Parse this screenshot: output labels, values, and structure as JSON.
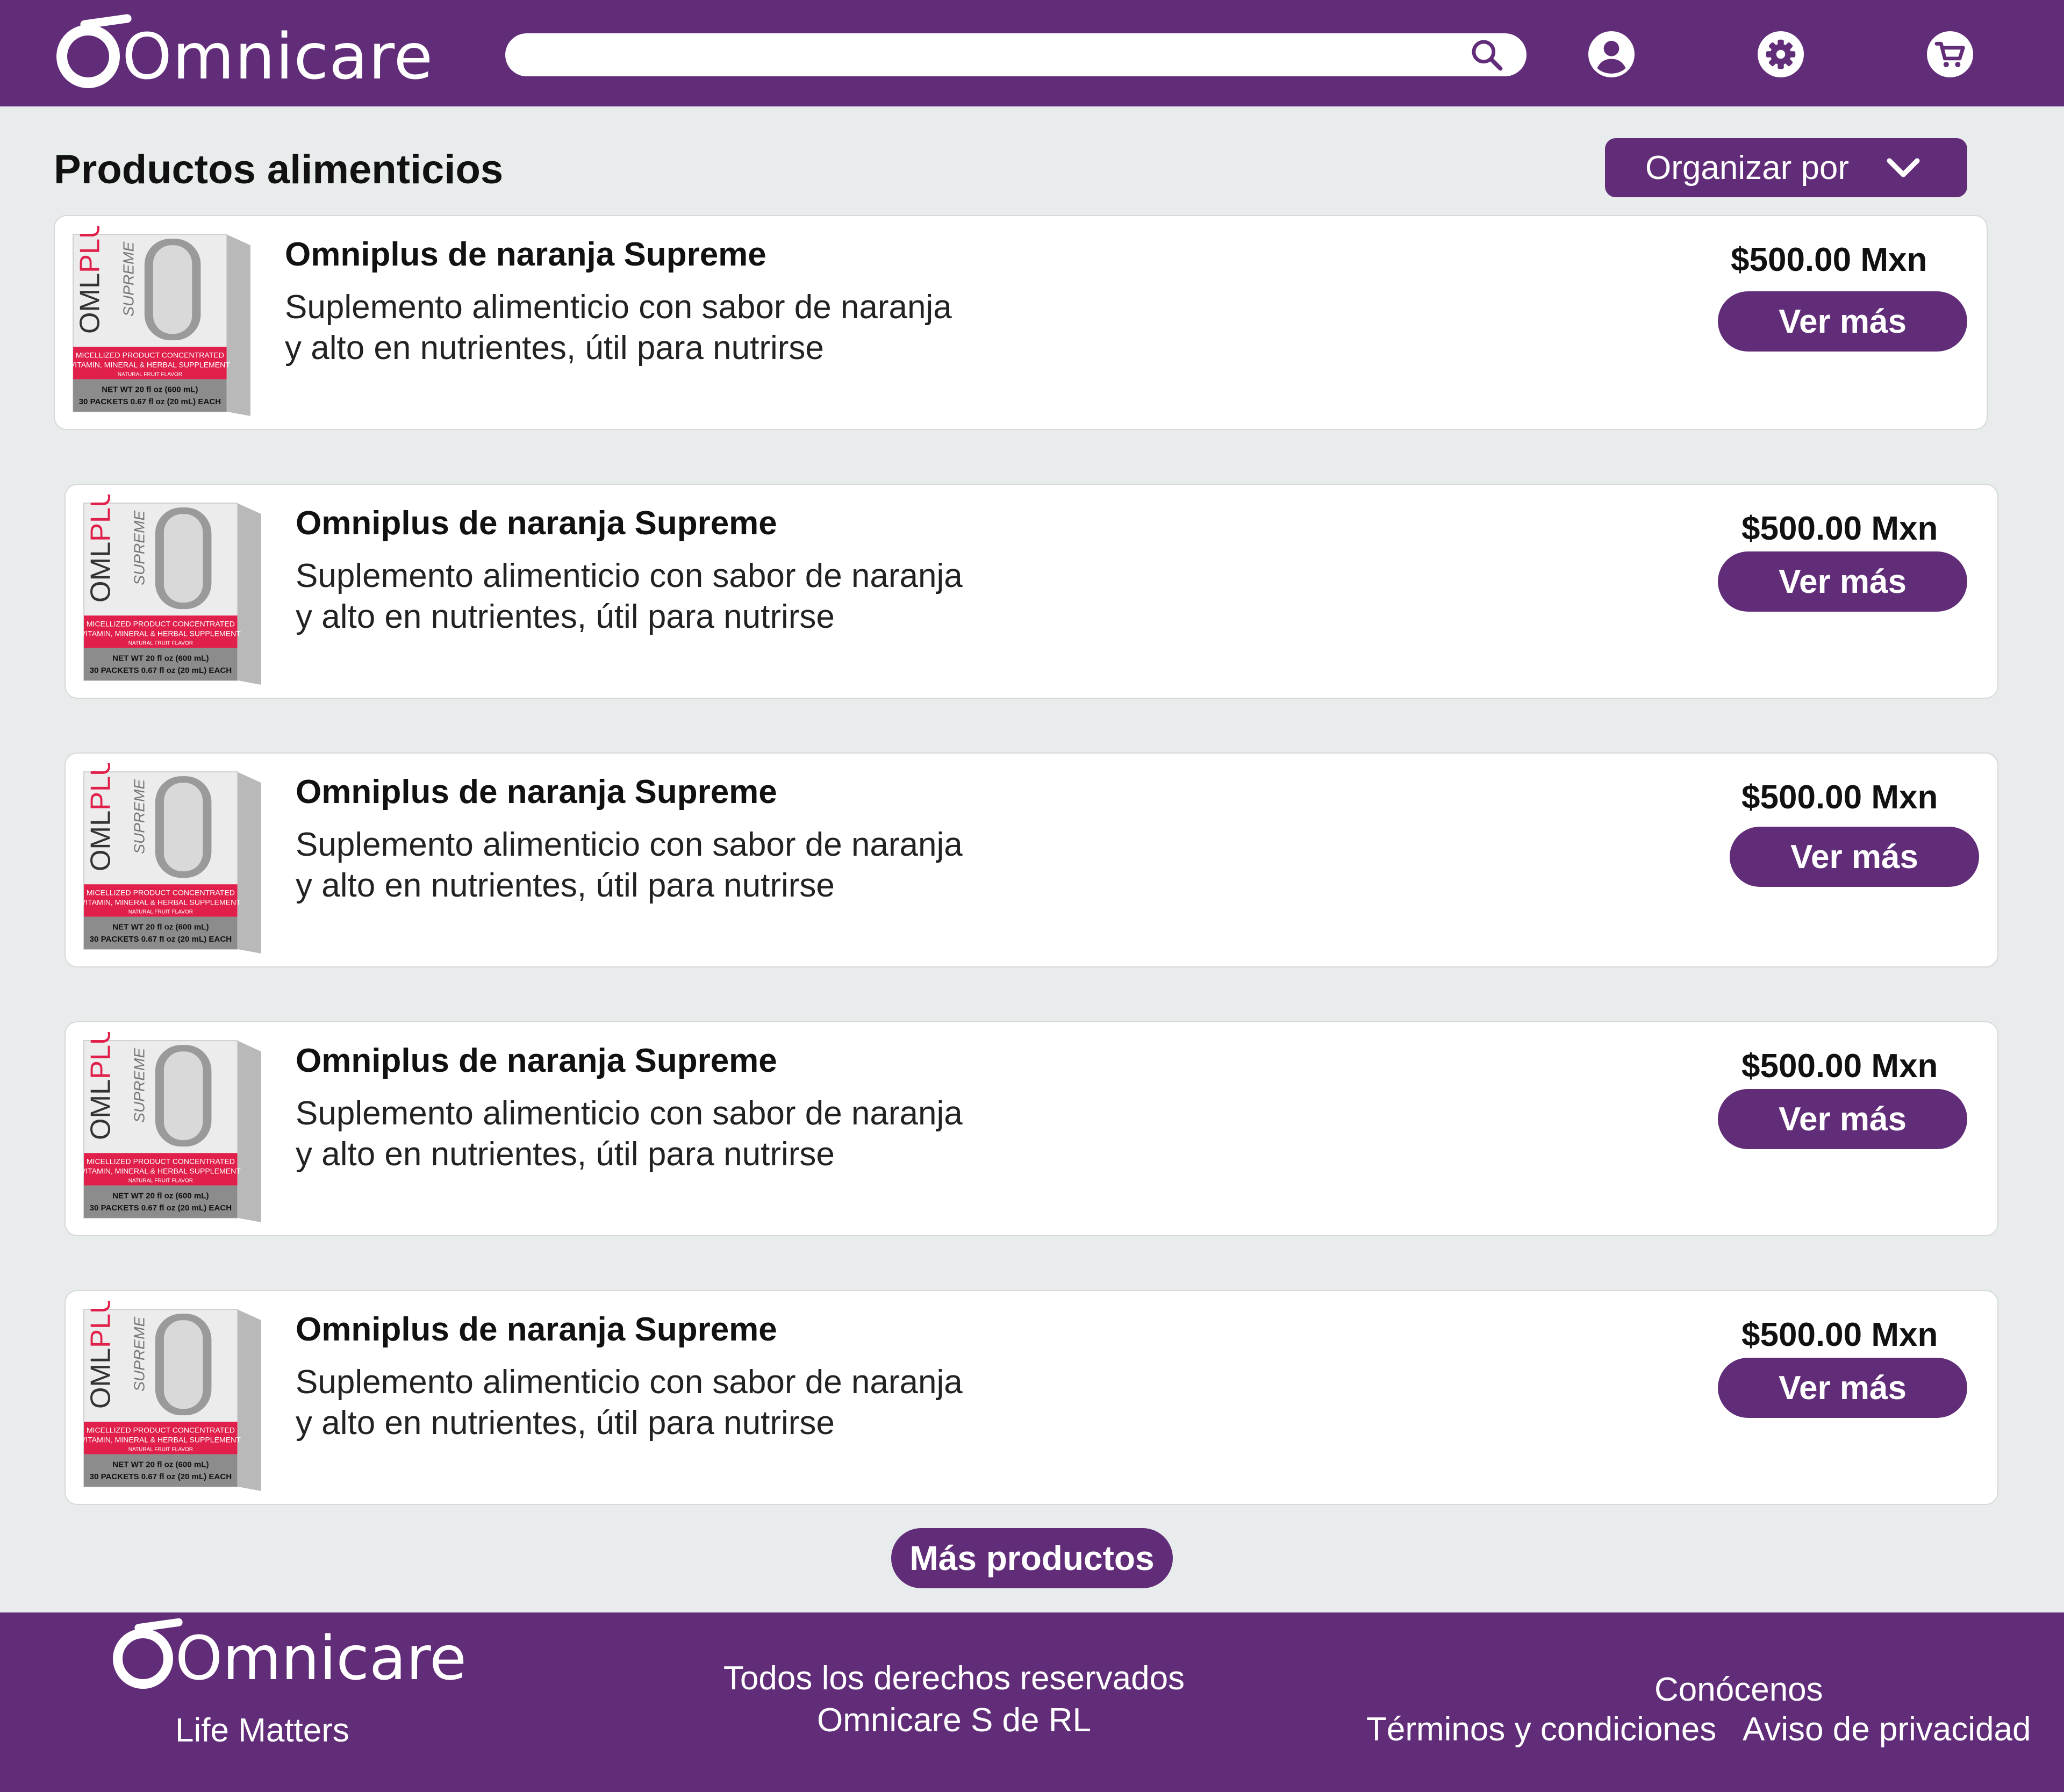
{
  "brand": {
    "name": "Omnicare",
    "tagline": "Life Matters",
    "color_primary": "#612c78",
    "color_background": "#e9ecec"
  },
  "header": {
    "search": {
      "value": "",
      "placeholder": "",
      "icon": "search-icon"
    },
    "icons": [
      "user-icon",
      "gear-icon",
      "cart-icon"
    ]
  },
  "main": {
    "title": "Productos alimenticios",
    "sort_label": "Organizar por",
    "products": [
      {
        "name": "Omniplus de naranja Supreme",
        "desc_line1": "Suplemento alimenticio con sabor de naranja",
        "desc_line2": "y alto en nutrientes, útil para nutrirse",
        "price": "$500.00 Mxn",
        "button": "Ver más"
      },
      {
        "name": "Omniplus de naranja Supreme",
        "desc_line1": "Suplemento alimenticio con sabor de naranja",
        "desc_line2": "y alto en nutrientes, útil para nutrirse",
        "price": "$500.00 Mxn",
        "button": "Ver más"
      },
      {
        "name": "Omniplus de naranja Supreme",
        "desc_line1": "Suplemento alimenticio con sabor de naranja",
        "desc_line2": "y alto en nutrientes, útil para nutrirse",
        "price": "$500.00 Mxn",
        "button": "Ver más"
      },
      {
        "name": "Omniplus de naranja Supreme",
        "desc_line1": "Suplemento alimenticio con sabor de naranja",
        "desc_line2": "y alto en nutrientes, útil para nutrirse",
        "price": "$500.00 Mxn",
        "button": "Ver más"
      },
      {
        "name": "Omniplus de naranja Supreme",
        "desc_line1": "Suplemento alimenticio con sabor de naranja",
        "desc_line2": "y alto en nutrientes, útil para nutrirse",
        "price": "$500.00 Mxn",
        "button": "Ver más"
      }
    ],
    "packaging": {
      "brand_a": "OML",
      "brand_b": "PLUS",
      "variant": "SUPREME",
      "band_line1": "MICELLIZED PRODUCT CONCENTRATED",
      "band_line2": "VITAMIN, MINERAL & HERBAL SUPPLEMENT",
      "band_line3": "NATURAL FRUIT FLAVOR",
      "net_line1": "NET WT 20 fl oz (600 mL)",
      "net_line2": "30 PACKETS 0.67 fl oz (20 mL) EACH"
    },
    "more_button": "Más productos"
  },
  "footer": {
    "rights_line1": "Todos los derechos reservados",
    "rights_line2": "Omnicare S de RL",
    "link_about": "Conócenos",
    "link_terms": "Términos y condiciones",
    "link_privacy": "Aviso de privacidad"
  }
}
